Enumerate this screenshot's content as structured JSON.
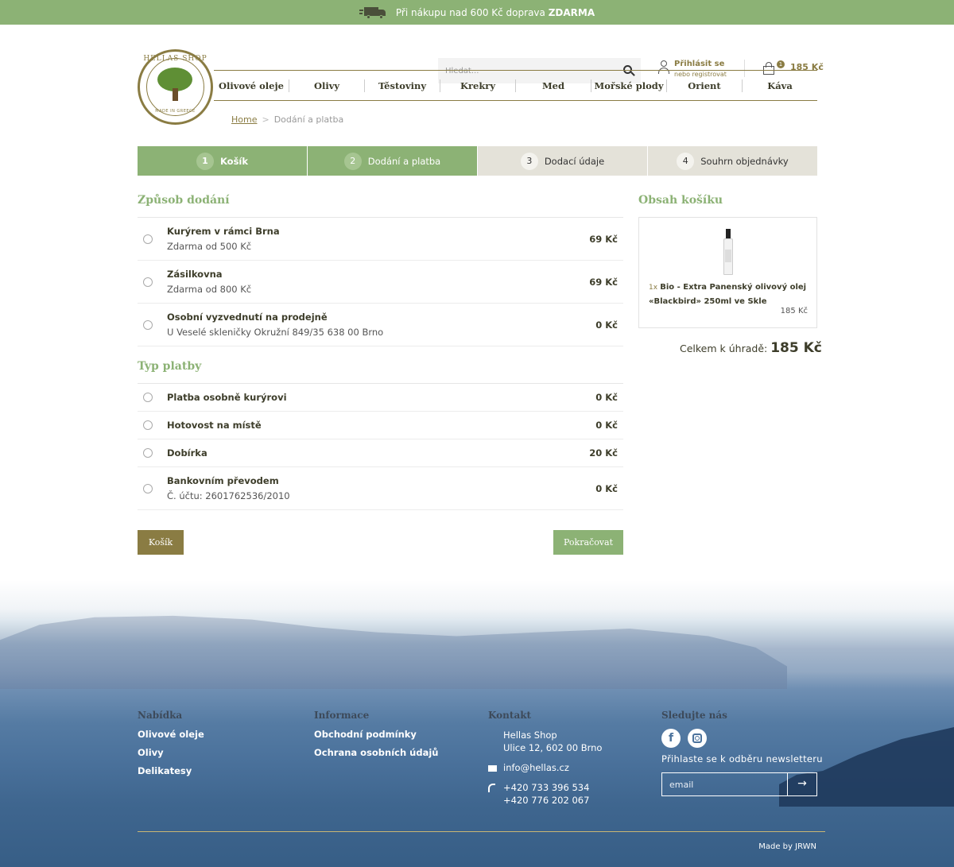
{
  "topbar": {
    "text_before": "Při nákupu nad 600 Kč doprava",
    "text_bold": "ZDARMA"
  },
  "logo": {
    "top": "HELLAS SHOP",
    "bottom": "MADE IN GREECE"
  },
  "search": {
    "placeholder": "Hledat..."
  },
  "account": {
    "login": "Přihlásit se",
    "register": "nebo registrovat"
  },
  "cart": {
    "count": "1",
    "total": "185 Kč"
  },
  "nav": [
    "Olivové oleje",
    "Olivy",
    "Těstoviny",
    "Krekry",
    "Med",
    "Mořské plody",
    "Orient",
    "Káva"
  ],
  "breadcrumb": {
    "home": "Home",
    "sep": ">",
    "current": "Dodání a platba"
  },
  "steps": [
    {
      "num": "1",
      "label": "Košík"
    },
    {
      "num": "2",
      "label": "Dodání a platba"
    },
    {
      "num": "3",
      "label": "Dodací údaje"
    },
    {
      "num": "4",
      "label": "Souhrn objednávky"
    }
  ],
  "delivery": {
    "title": "Způsob dodání",
    "options": [
      {
        "name": "Kurýrem v rámci Brna",
        "sub": "Zdarma od 500 Kč",
        "price": "69 Kč"
      },
      {
        "name": "Zásilkovna",
        "sub": "Zdarma od 800 Kč",
        "price": "69 Kč"
      },
      {
        "name": "Osobní vyzvednutí na prodejně",
        "sub": "U Veselé skleničky Okružní 849/35 638 00 Brno",
        "price": "0 Kč"
      }
    ]
  },
  "payment": {
    "title": "Typ platby",
    "options": [
      {
        "name": "Platba osobně kurýrovi",
        "price": "0 Kč"
      },
      {
        "name": "Hotovost na místě",
        "price": "0 Kč"
      },
      {
        "name": "Dobírka",
        "price": "20 Kč"
      },
      {
        "name": "Bankovním převodem",
        "sub": "Č. účtu: 2601762536/2010",
        "price": "0 Kč"
      }
    ]
  },
  "buttons": {
    "back": "Košík",
    "next": "Pokračovat"
  },
  "summary": {
    "title": "Obsah košíku",
    "item_qty": "1x",
    "item_name": "Bio - Extra Panenský olivový olej «Blackbird» 250ml ve Skle",
    "item_price": "185 Kč",
    "total_label": "Celkem k úhradě:",
    "total_value": "185 Kč"
  },
  "footer": {
    "offer": {
      "title": "Nabídka",
      "links": [
        "Olivové oleje",
        "Olivy",
        "Delikatesy"
      ]
    },
    "info": {
      "title": "Informace",
      "links": [
        "Obchodní podmínky",
        "Ochrana osobních údajů"
      ]
    },
    "contact": {
      "title": "Kontakt",
      "address1": "Hellas Shop",
      "address2": "Ulice 12, 602 00 Brno",
      "email": "info@hellas.cz",
      "phone1": "+420 733 396 534",
      "phone2": "+420 776 202 067"
    },
    "follow": {
      "title": "Sledujte nás",
      "facebook": "f",
      "newsletter": "Přihlaste se k odběru newsletteru",
      "email_placeholder": "email",
      "submit": "→"
    },
    "made_by": "Made by JRWN"
  },
  "colors": {
    "green": "#8cb275",
    "olive": "#8a7c43"
  }
}
